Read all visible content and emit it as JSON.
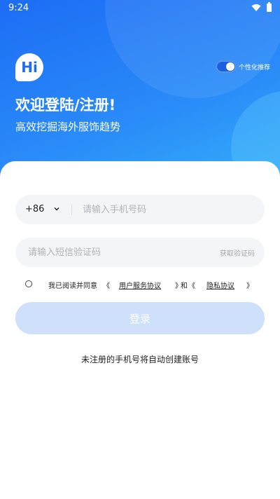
{
  "status_bar": {
    "time": "9:24"
  },
  "header": {
    "logo_text": "Hi",
    "title": "欢迎登陆/注册!",
    "subtitle": "高效挖掘海外服饰趋势",
    "personalization": {
      "label": "个性化推荐",
      "enabled": true
    }
  },
  "form": {
    "country_code": "+86",
    "phone_placeholder": "请输入手机号码",
    "code_placeholder": "请输入短信验证码",
    "get_code_label": "获取验证码",
    "agreement": {
      "checked": false,
      "prefix": "我已阅读并同意",
      "open_bracket": "《",
      "user_agreement": "用户服务协议",
      "close_bracket": "》",
      "and": "和",
      "privacy_policy": "隐私协议"
    },
    "login_label": "登录",
    "footer_note": "未注册的手机号将自动创建账号"
  },
  "colors": {
    "primary": "#1d6cf5",
    "login_disabled": "#cfe0fb",
    "field_bg": "#f4f5f7"
  }
}
